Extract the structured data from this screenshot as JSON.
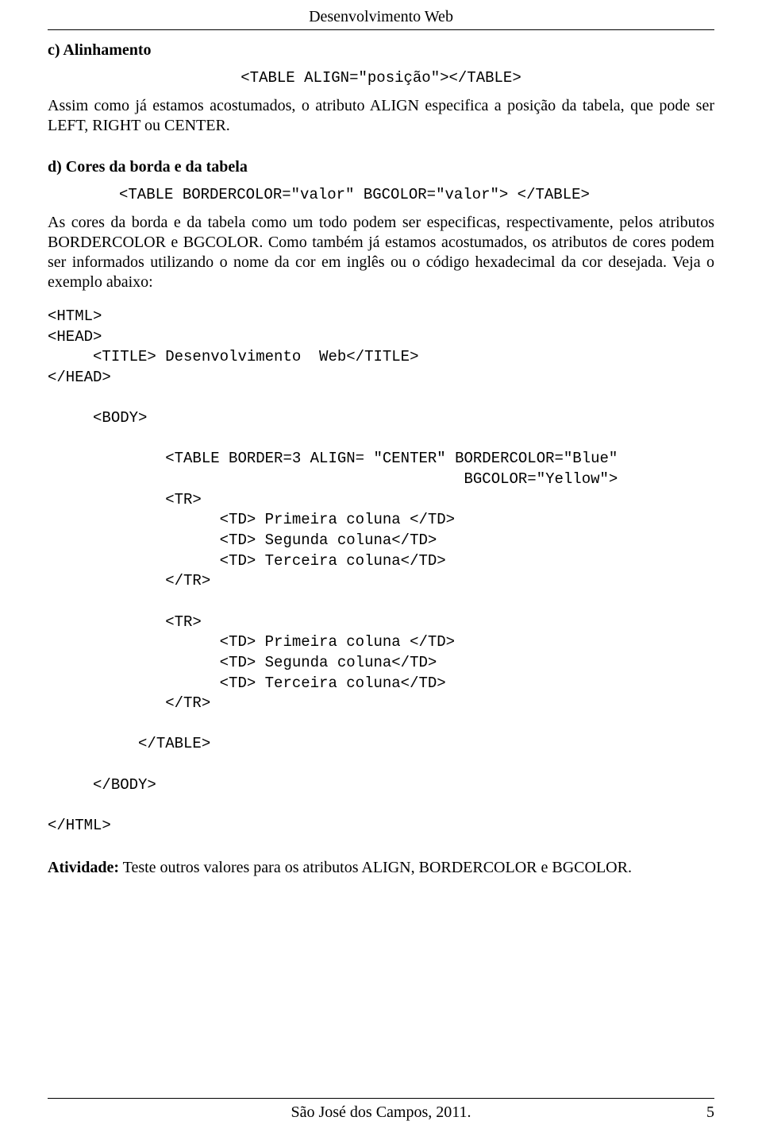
{
  "header": {
    "title": "Desenvolvimento Web"
  },
  "section_c": {
    "heading": "c) Alinhamento",
    "code": "<TABLE ALIGN=\"posição\"></TABLE>",
    "para": "Assim como já estamos acostumados, o atributo ALIGN especifica a posição da tabela, que pode ser LEFT, RIGHT ou CENTER."
  },
  "section_d": {
    "heading": "d) Cores da borda e da tabela",
    "code": "<TABLE BORDERCOLOR=\"valor\" BGCOLOR=\"valor\"> </TABLE>",
    "para": "As cores da borda e da tabela como um todo podem ser especificas, respectivamente, pelos atributos BORDERCOLOR e BGCOLOR. Como também já estamos acostumados, os atributos de cores podem ser informados utilizando o nome da cor em inglês ou o código hexadecimal da cor desejada. Veja o exemplo abaixo:"
  },
  "example_code": "<HTML>\n<HEAD>\n     <TITLE> Desenvolvimento  Web</TITLE>\n</HEAD>\n\n     <BODY>\n\n             <TABLE BORDER=3 ALIGN= \"CENTER\" BORDERCOLOR=\"Blue\"\n                                              BGCOLOR=\"Yellow\">\n             <TR>\n                   <TD> Primeira coluna </TD>\n                   <TD> Segunda coluna</TD>\n                   <TD> Terceira coluna</TD>\n             </TR>\n\n             <TR>\n                   <TD> Primeira coluna </TD>\n                   <TD> Segunda coluna</TD>\n                   <TD> Terceira coluna</TD>\n             </TR>\n\n          </TABLE>\n\n     </BODY>\n\n</HTML>",
  "activity": {
    "label": "Atividade:",
    "text": " Teste outros valores para os atributos ALIGN, BORDERCOLOR e BGCOLOR."
  },
  "footer": {
    "center": "São José dos Campos, 2011.",
    "page_number": "5"
  }
}
